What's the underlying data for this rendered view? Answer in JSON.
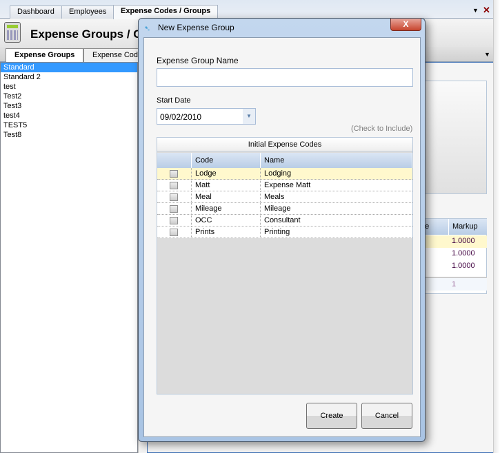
{
  "top_tabs": [
    {
      "label": "Dashboard"
    },
    {
      "label": "Employees"
    },
    {
      "label": "Expense Codes / Groups",
      "active": true
    }
  ],
  "header": {
    "title": "Expense Groups / Codes",
    "icon": "calculator-icon"
  },
  "sub_tabs": [
    {
      "label": "Expense Groups",
      "active": true
    },
    {
      "label": "Expense Codes"
    }
  ],
  "groups": [
    "Standard",
    "Standard 2",
    "test",
    "Test2",
    "Test3",
    "test4",
    "TEST5",
    "Test8"
  ],
  "background_table": {
    "headers": [
      "pe",
      "Markup"
    ],
    "markup_values": [
      "1.0000",
      "1.0000",
      "1.0000"
    ],
    "footer_value": "1"
  },
  "dialog": {
    "title": "New Expense Group",
    "close_label": "X",
    "name_label": "Expense Group Name",
    "name_value": "",
    "start_date_label": "Start Date",
    "start_date_value": "09/02/2010",
    "check_hint": "(Check to Include)",
    "grid_title": "Initial Expense Codes",
    "columns": [
      "Code",
      "Name"
    ],
    "rows": [
      {
        "code": "Lodge",
        "name": "Lodging",
        "checked": false
      },
      {
        "code": "Matt",
        "name": "Expense Matt",
        "checked": false
      },
      {
        "code": "Meal",
        "name": "Meals",
        "checked": false
      },
      {
        "code": "Mileage",
        "name": "Mileage",
        "checked": false
      },
      {
        "code": "OCC",
        "name": "Consultant",
        "checked": false
      },
      {
        "code": "Prints",
        "name": "Printing",
        "checked": false
      }
    ],
    "create_label": "Create",
    "cancel_label": "Cancel"
  },
  "colors": {
    "selection": "#3399ff",
    "row_highlight": "#fff8cd",
    "close_red": "#c7452e"
  }
}
